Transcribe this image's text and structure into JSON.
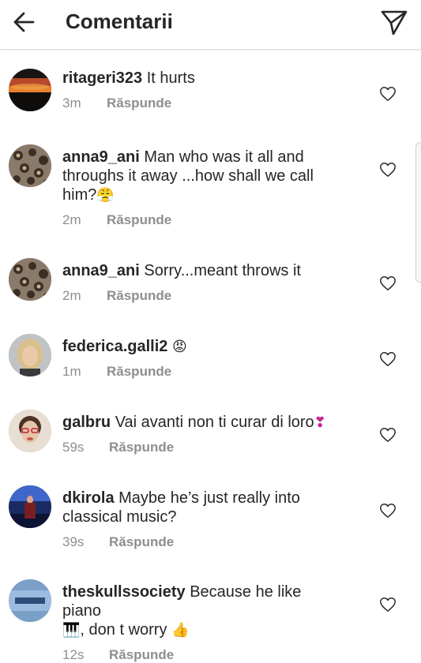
{
  "header": {
    "title": "Comentarii",
    "back_icon": "arrow-left-icon",
    "share_icon": "paper-plane-icon"
  },
  "reply_label": "Răspunde",
  "comments": [
    {
      "username": "ritageri323",
      "text": "It hurts",
      "time": "3m",
      "reply": "Răspunde",
      "avatar_icon": "sunset-photo"
    },
    {
      "username": "anna9_ani",
      "text": "Man who was it all and throughs it away ...how shall we call him?",
      "emoji": "😤",
      "time": "2m",
      "reply": "Răspunde",
      "avatar_icon": "leopard-print-photo"
    },
    {
      "username": "anna9_ani",
      "text": "Sorry...meant throws it",
      "time": "2m",
      "reply": "Răspunde",
      "avatar_icon": "leopard-print-photo"
    },
    {
      "username": "federica.galli2",
      "text": "",
      "emoji": "😡",
      "time": "1m",
      "reply": "Răspunde",
      "avatar_icon": "blonde-woman-photo"
    },
    {
      "username": "galbru",
      "text": "Vai avanti non ti curar di loro",
      "emoji": "❣",
      "time": "59s",
      "reply": "Răspunde",
      "avatar_icon": "woman-glasses-photo"
    },
    {
      "username": "dkirola",
      "text": "Maybe he’s just really into classical music?",
      "time": "39s",
      "reply": "Răspunde",
      "avatar_icon": "stage-photo"
    },
    {
      "username": "theskullssociety",
      "text": "Because he like piano",
      "text2": ", don t worry",
      "piano_emoji": "🎹",
      "thumb_emoji": "👍",
      "time": "12s",
      "reply": "Răspunde",
      "avatar_icon": "logo-badge"
    }
  ],
  "colors": {
    "text": "#262626",
    "secondary": "#8e8e8e",
    "divider": "#dbdbdb"
  }
}
